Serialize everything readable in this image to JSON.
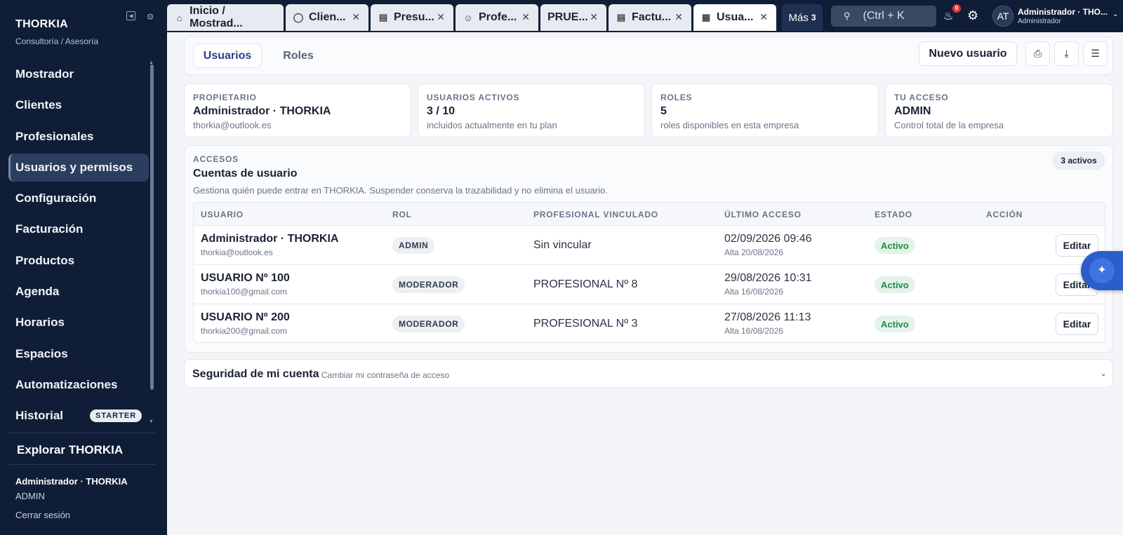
{
  "sidebar": {
    "brand_title": "THORKIA",
    "brand_subtitle": "Consultoría / Asesoría",
    "items": [
      {
        "label": "Mostrador"
      },
      {
        "label": "Clientes"
      },
      {
        "label": "Profesionales"
      },
      {
        "label": "Usuarios y permisos",
        "active": true
      },
      {
        "label": "Configuración"
      },
      {
        "label": "Facturación"
      },
      {
        "label": "Productos"
      },
      {
        "label": "Agenda"
      },
      {
        "label": "Horarios"
      },
      {
        "label": "Espacios"
      },
      {
        "label": "Automatizaciones"
      },
      {
        "label": "Historial",
        "badge": "STARTER"
      }
    ],
    "explore": "Explorar THORKIA",
    "user_name": "Administrador · THORKIA",
    "user_role": "ADMIN",
    "logout": "Cerrar sesión"
  },
  "topbar": {
    "tabs": [
      {
        "label": "Inicio / Mostrad...",
        "icon": "home-icon"
      },
      {
        "label": "Clien...",
        "icon": "user-icon"
      },
      {
        "label": "Presu...",
        "icon": "document-icon"
      },
      {
        "label": "Profe...",
        "icon": "person-icon"
      },
      {
        "label": "PRUE..."
      },
      {
        "label": "Factu...",
        "icon": "invoice-icon"
      },
      {
        "label": "Usua...",
        "icon": "grid-icon",
        "active": true
      }
    ],
    "more_label": "Más",
    "more_count": "3",
    "search_placeholder": "(Ctrl + K",
    "notification_count": "0",
    "avatar_initials": "AT",
    "user_name": "Administrador · THO...",
    "user_role": "Administrador"
  },
  "subtabs": {
    "users": "Usuarios",
    "roles": "Roles",
    "new_user": "Nuevo usuario"
  },
  "stats": [
    {
      "label": "PROPIETARIO",
      "value": "Administrador · THORKIA",
      "hint": "thorkia@outlook.es"
    },
    {
      "label": "USUARIOS ACTIVOS",
      "value": "3 / 10",
      "hint": "incluidos actualmente en tu plan"
    },
    {
      "label": "ROLES",
      "value": "5",
      "hint": "roles disponibles en esta empresa"
    },
    {
      "label": "TU ACCESO",
      "value": "ADMIN",
      "hint": "Control total de la empresa"
    }
  ],
  "accounts": {
    "kicker": "ACCESOS",
    "title": "Cuentas de usuario",
    "description": "Gestiona quién puede entrar en THORKIA. Suspender conserva la trazabilidad y no elimina el usuario.",
    "count": "3 activos",
    "columns": [
      "USUARIO",
      "ROL",
      "PROFESIONAL VINCULADO",
      "ÚLTIMO ACCESO",
      "ESTADO",
      "ACCIÓN"
    ],
    "rows": [
      {
        "name": "Administrador · THORKIA",
        "email": "thorkia@outlook.es",
        "role": "ADMIN",
        "professional": "Sin vincular",
        "last_access": "02/09/2026 09:46",
        "since": "Alta 20/08/2026",
        "status": "Activo",
        "action": "Editar"
      },
      {
        "name": "USUARIO Nº 100",
        "email": "thorkia100@gmail.com",
        "role": "MODERADOR",
        "professional": "PROFESIONAL Nº 8",
        "last_access": "29/08/2026 10:31",
        "since": "Alta 16/08/2026",
        "status": "Activo",
        "action": "Editar"
      },
      {
        "name": "USUARIO Nº 200",
        "email": "thorkia200@gmail.com",
        "role": "MODERADOR",
        "professional": "PROFESIONAL Nº 3",
        "last_access": "27/08/2026 11:13",
        "since": "Alta 16/08/2026",
        "status": "Activo",
        "action": "Editar"
      }
    ]
  },
  "security": {
    "title": "Seguridad de mi cuenta",
    "description": "Cambiar mi contraseña de acceso"
  },
  "colors": {
    "sidebar_bg": "#0f1e36",
    "accent": "#2c3e8c",
    "status_active": "#1f8a4c",
    "fab": "#2c5ec9"
  }
}
